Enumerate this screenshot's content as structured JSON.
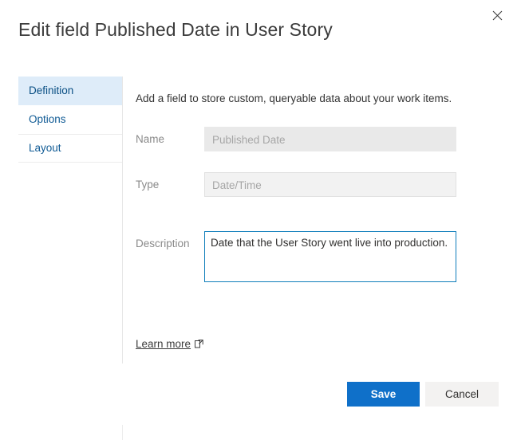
{
  "dialog": {
    "title": "Edit field Published Date in User Story",
    "close_icon": "close-icon"
  },
  "pivot": {
    "items": [
      {
        "label": "Definition",
        "selected": true
      },
      {
        "label": "Options",
        "selected": false
      },
      {
        "label": "Layout",
        "selected": false
      }
    ]
  },
  "pane": {
    "intro": "Add a field to store custom, queryable data about your work items.",
    "fields": {
      "name": {
        "label": "Name",
        "value": "Published Date",
        "placeholder": "Published Date",
        "disabled": true
      },
      "type": {
        "label": "Type",
        "value": "Date/Time",
        "placeholder": "Date/Time",
        "disabled": true
      },
      "description": {
        "label": "Description",
        "value": "Date that the User Story went live into production.",
        "placeholder": "Description",
        "focused": true
      }
    },
    "learn_more": {
      "label": "Learn more",
      "icon": "external-link-icon"
    }
  },
  "footer": {
    "save_label": "Save",
    "cancel_label": "Cancel"
  },
  "colors": {
    "accent": "#0f70c9",
    "selected_tab_bg": "#deecf9",
    "link": "#0f5a94",
    "focus_border": "#107ebb",
    "disabled_bg": "#e9e9e9",
    "cancel_bg": "#f3f2f1"
  }
}
